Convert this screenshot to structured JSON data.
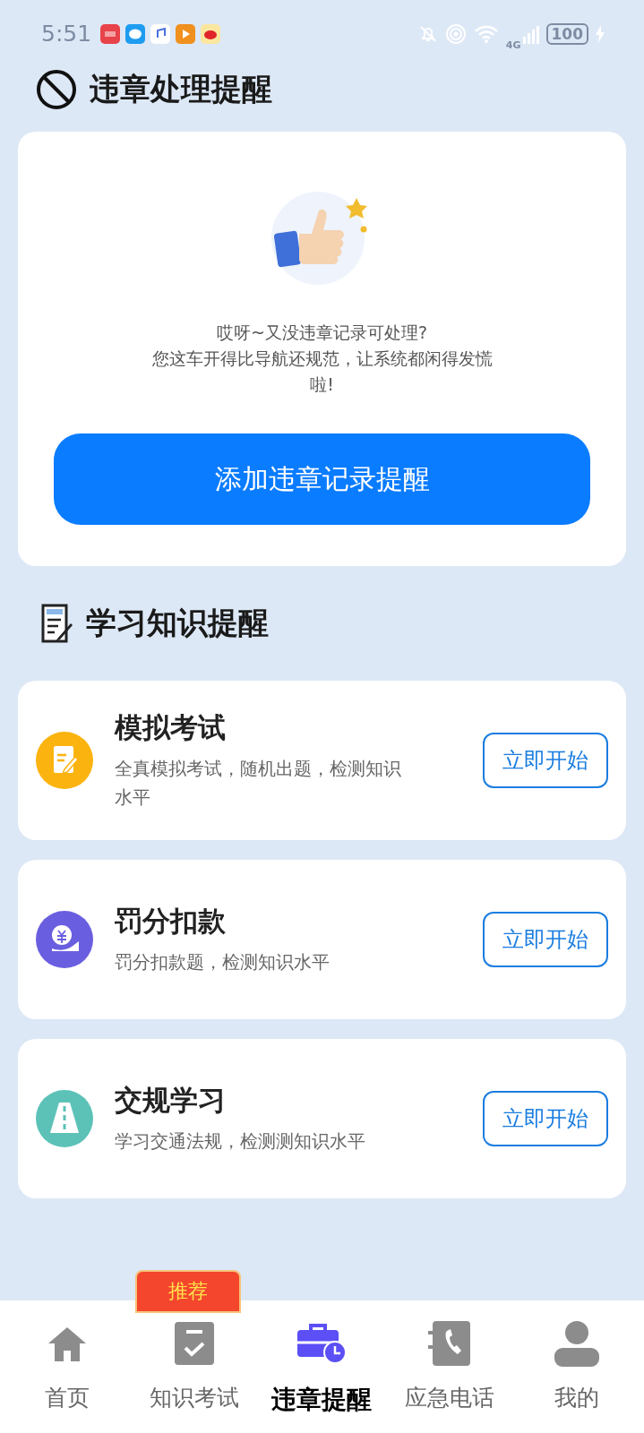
{
  "status_bar": {
    "time": "5:51",
    "network": "4G",
    "battery": "100"
  },
  "violation_section": {
    "title": "违章处理提醒",
    "message_lines": [
      "哎呀~又没违章记录可处理?",
      "您这车开得比导航还规范，让系统都闲得发慌",
      "啦!"
    ],
    "button": "添加违章记录提醒"
  },
  "study_section": {
    "title": "学习知识提醒",
    "items": [
      {
        "kind": "exam",
        "color": "#fbb30f",
        "title": "模拟考试",
        "description": "全真模拟考试，随机出题，检测知识水平",
        "button": "立即开始"
      },
      {
        "kind": "fine",
        "color": "#6a5ee0",
        "title": "罚分扣款",
        "description": "罚分扣款题，检测知识水平",
        "button": "立即开始"
      },
      {
        "kind": "road",
        "color": "#5cc2b8",
        "title": "交规学习",
        "description": "学习交通法规，检测测知识水平",
        "button": "立即开始"
      }
    ]
  },
  "bottom_nav": [
    {
      "kind": "home",
      "label": "首页",
      "selected": false
    },
    {
      "kind": "exam",
      "label": "知识考试",
      "selected": false,
      "badge": "推荐"
    },
    {
      "kind": "violation",
      "label": "违章提醒",
      "selected": true
    },
    {
      "kind": "phone",
      "label": "应急电话",
      "selected": false
    },
    {
      "kind": "profile",
      "label": "我的",
      "selected": false
    }
  ]
}
